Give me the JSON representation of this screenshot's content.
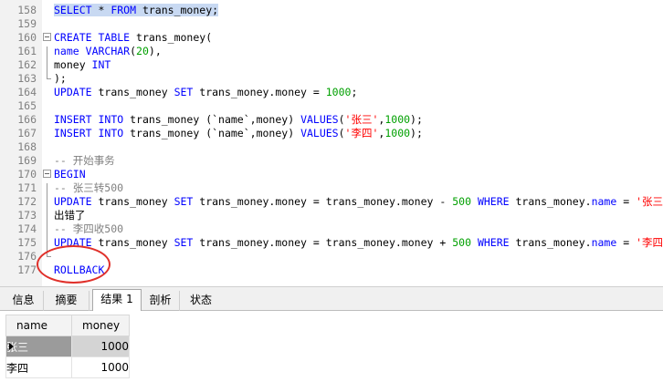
{
  "editor": {
    "lines": [
      {
        "num": "158",
        "tokens": [
          {
            "t": "SELECT",
            "c": "kw hl"
          },
          {
            "t": " * ",
            "c": "hl"
          },
          {
            "t": "FROM",
            "c": "kw hl"
          },
          {
            "t": " trans_money;",
            "c": "hl"
          }
        ]
      },
      {
        "num": "159",
        "tokens": []
      },
      {
        "num": "160",
        "tokens": [
          {
            "t": "CREATE",
            "c": "kw"
          },
          {
            "t": " "
          },
          {
            "t": "TABLE",
            "c": "kw"
          },
          {
            "t": " trans_money("
          }
        ]
      },
      {
        "num": "161",
        "tokens": [
          {
            "t": "name",
            "c": "kw"
          },
          {
            "t": " "
          },
          {
            "t": "VARCHAR",
            "c": "kw"
          },
          {
            "t": "("
          },
          {
            "t": "20",
            "c": "num"
          },
          {
            "t": "),"
          }
        ]
      },
      {
        "num": "162",
        "tokens": [
          {
            "t": "money "
          },
          {
            "t": "INT",
            "c": "kw"
          }
        ]
      },
      {
        "num": "163",
        "tokens": [
          {
            "t": ");"
          }
        ]
      },
      {
        "num": "164",
        "tokens": [
          {
            "t": "UPDATE",
            "c": "kw"
          },
          {
            "t": " trans_money "
          },
          {
            "t": "SET",
            "c": "kw"
          },
          {
            "t": " trans_money.money = "
          },
          {
            "t": "1000",
            "c": "num"
          },
          {
            "t": ";"
          }
        ]
      },
      {
        "num": "165",
        "tokens": []
      },
      {
        "num": "166",
        "tokens": [
          {
            "t": "INSERT",
            "c": "kw"
          },
          {
            "t": " "
          },
          {
            "t": "INTO",
            "c": "kw"
          },
          {
            "t": " trans_money (`name`,money) "
          },
          {
            "t": "VALUES",
            "c": "kw"
          },
          {
            "t": "("
          },
          {
            "t": "'张三'",
            "c": "str"
          },
          {
            "t": ","
          },
          {
            "t": "1000",
            "c": "num"
          },
          {
            "t": ");"
          }
        ]
      },
      {
        "num": "167",
        "tokens": [
          {
            "t": "INSERT",
            "c": "kw"
          },
          {
            "t": " "
          },
          {
            "t": "INTO",
            "c": "kw"
          },
          {
            "t": " trans_money (`name`,money) "
          },
          {
            "t": "VALUES",
            "c": "kw"
          },
          {
            "t": "("
          },
          {
            "t": "'李四'",
            "c": "str"
          },
          {
            "t": ","
          },
          {
            "t": "1000",
            "c": "num"
          },
          {
            "t": ");"
          }
        ]
      },
      {
        "num": "168",
        "tokens": []
      },
      {
        "num": "169",
        "tokens": [
          {
            "t": "-- 开始事务",
            "c": "cmt"
          }
        ]
      },
      {
        "num": "170",
        "tokens": [
          {
            "t": "BEGIN",
            "c": "kw"
          }
        ]
      },
      {
        "num": "171",
        "tokens": [
          {
            "t": "-- 张三转500",
            "c": "cmt"
          }
        ]
      },
      {
        "num": "172",
        "tokens": [
          {
            "t": "UPDATE",
            "c": "kw"
          },
          {
            "t": " trans_money "
          },
          {
            "t": "SET",
            "c": "kw"
          },
          {
            "t": " trans_money.money = trans_money.money - "
          },
          {
            "t": "500",
            "c": "num"
          },
          {
            "t": " "
          },
          {
            "t": "WHERE",
            "c": "kw"
          },
          {
            "t": " trans_money."
          },
          {
            "t": "name",
            "c": "kw"
          },
          {
            "t": " = "
          },
          {
            "t": "'张三'",
            "c": "str"
          }
        ]
      },
      {
        "num": "173",
        "tokens": [
          {
            "t": "出错了"
          }
        ]
      },
      {
        "num": "174",
        "tokens": [
          {
            "t": "-- 李四收500",
            "c": "cmt"
          }
        ]
      },
      {
        "num": "175",
        "tokens": [
          {
            "t": "UPDATE",
            "c": "kw"
          },
          {
            "t": " trans_money "
          },
          {
            "t": "SET",
            "c": "kw"
          },
          {
            "t": " trans_money.money = trans_money.money + "
          },
          {
            "t": "500",
            "c": "num"
          },
          {
            "t": " "
          },
          {
            "t": "WHERE",
            "c": "kw"
          },
          {
            "t": " trans_money."
          },
          {
            "t": "name",
            "c": "kw"
          },
          {
            "t": " = "
          },
          {
            "t": "'李四'",
            "c": "str"
          }
        ]
      },
      {
        "num": "176",
        "tokens": []
      },
      {
        "num": "177",
        "tokens": [
          {
            "t": "ROLLBACK",
            "c": "kw"
          }
        ]
      }
    ]
  },
  "tabs": [
    {
      "label": "信息",
      "active": false
    },
    {
      "label": "摘要",
      "active": false
    },
    {
      "label": "结果 1",
      "active": true
    },
    {
      "label": "剖析",
      "active": false
    },
    {
      "label": "状态",
      "active": false
    }
  ],
  "results": {
    "columns": [
      "name",
      "money"
    ],
    "rows": [
      {
        "name": "张三",
        "money": "1000",
        "selected": true
      },
      {
        "name": "李四",
        "money": "1000",
        "selected": false
      }
    ]
  },
  "colors": {
    "keyword": "#0000ff",
    "number": "#00a000",
    "string": "#ff0000",
    "comment": "#808080",
    "selection": "#c8d9f2",
    "annotation": "#e0302a"
  }
}
